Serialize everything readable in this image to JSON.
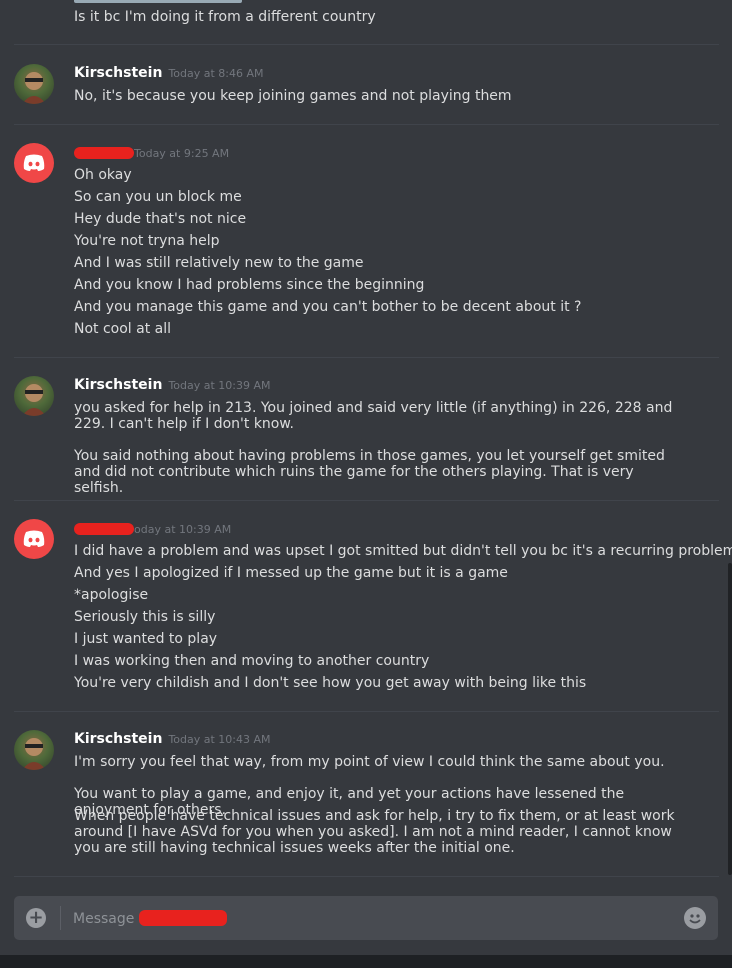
{
  "top_message": "Is it bc I'm doing it from a different country",
  "groups": [
    {
      "author": "Kirschstein",
      "timestamp": "Today at 8:46 AM",
      "lines": [
        "No, it's because you keep joining games and not playing them"
      ]
    },
    {
      "author": "",
      "timestamp": "Today at 9:25 AM",
      "lines": [
        "Oh okay",
        "So can you un block me",
        "Hey dude that's not nice",
        "You're not tryna help",
        "And I was still relatively new to the game",
        "And you know I had problems since the beginning",
        "And you manage this game and you can't bother to be decent about it ?",
        "Not cool at all"
      ]
    },
    {
      "author": "Kirschstein",
      "timestamp": "Today at 10:39 AM",
      "paragraphs": [
        "you asked for help in 213. You joined and said very little (if anything) in 226, 228 and 229. I can't help if I don't know.",
        "You said nothing about having problems in those games, you let yourself get smited and did not contribute which ruins the game for the others playing. That is very selfish."
      ]
    },
    {
      "author": "",
      "timestamp": "Today at 10:39 AM",
      "timestamp_shown": "oday at 10:39 AM",
      "lines": [
        "I did have a problem and was upset I got smitted but didn't tell you bc it's a recurring problem",
        "And yes I apologized if I messed up the game but it is a game",
        "*apologise",
        "Seriously this is silly",
        "I just wanted to play",
        "I was working then and moving to another country",
        "You're very childish and I don't see how you get away with being like this"
      ]
    },
    {
      "author": "Kirschstein",
      "timestamp": "Today at 10:43 AM",
      "paragraphs": [
        "I'm sorry you feel that way, from my point of view I could think the same about you.",
        "You want to play a game, and enjoy it, and yet your actions have lessened the enjoyment for others.",
        "When people have technical issues and ask for help, i try to fix them, or at least work around [I have ASVd for you when you asked]. I am not a mind reader, I cannot know you are still having technical issues weeks after the initial one."
      ]
    }
  ],
  "composer": {
    "placeholder": "Message "
  },
  "icons": {
    "add": "plus-circle-icon",
    "emoji": "emoji-icon",
    "discord": "discord-logo-icon"
  },
  "colors": {
    "background": "#36393e",
    "redaction": "#e8221e",
    "discord_avatar": "#f04747"
  }
}
